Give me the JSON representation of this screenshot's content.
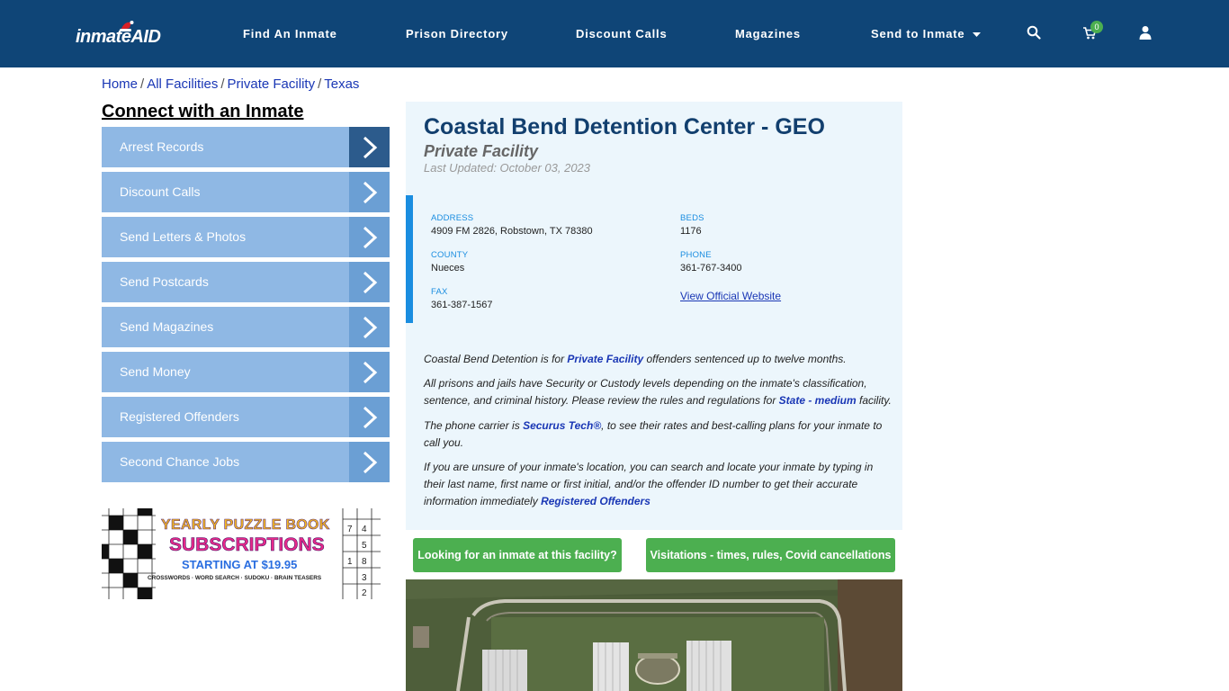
{
  "brand": {
    "logo_main": "inmate",
    "logo_accent": "AID"
  },
  "nav": {
    "items": [
      "Find An Inmate",
      "Prison Directory",
      "Discount Calls",
      "Magazines",
      "Send to Inmate"
    ],
    "cart_count": "0",
    "icons": [
      "search-icon",
      "cart-icon",
      "user-icon"
    ]
  },
  "breadcrumb": [
    "Home",
    "All Facilities",
    "Private Facility",
    "Texas"
  ],
  "sidebar": {
    "title": "Connect with an Inmate",
    "items": [
      "Arrest Records",
      "Discount Calls",
      "Send Letters & Photos",
      "Send Postcards",
      "Send Magazines",
      "Send Money",
      "Registered Offenders",
      "Second Chance Jobs"
    ]
  },
  "ad": {
    "line1": "YEARLY PUZZLE BOOK",
    "line2": "SUBSCRIPTIONS",
    "line3": "STARTING AT $19.95",
    "line4": "CROSSWORDS · WORD SEARCH · SUDOKU · BRAIN TEASERS"
  },
  "facility": {
    "name": "Coastal Bend Detention Center - GEO",
    "type": "Private Facility",
    "updated": "Last Updated: October 03, 2023",
    "address_label": "ADDRESS",
    "address": "4909 FM 2826, Robstown, TX 78380",
    "beds_label": "BEDS",
    "beds": "1176",
    "county_label": "COUNTY",
    "county": "Nueces",
    "phone_label": "PHONE",
    "phone": "361-767-3400",
    "fax_label": "FAX",
    "fax": "361-387-1567",
    "website_link": "View Official Website"
  },
  "description": {
    "p1_a": "Coastal Bend Detention is for ",
    "p1_link": "Private Facility",
    "p1_b": " offenders sentenced up to twelve months.",
    "p2_a": "All prisons and jails have Security or Custody levels depending on the inmate's classification, sentence, and criminal history. Please review the rules and regulations for ",
    "p2_link": "State - medium",
    "p2_b": " facility.",
    "p3_a": "The phone carrier is ",
    "p3_link": "Securus Tech®",
    "p3_b": ", to see their rates and best-calling plans for your inmate to call you.",
    "p4_a": "If you are unsure of your inmate's location, you can search and locate your inmate by typing in their last name, first name or first initial, and/or the offender ID number to get their accurate information immediately ",
    "p4_link": "Registered Offenders"
  },
  "buttons": {
    "looking": "Looking for an inmate at this facility?",
    "visitations": "Visitations - times, rules, Covid cancellations"
  },
  "colors": {
    "header": "#0f4577",
    "accent_blue": "#1a8de0",
    "link": "#1a37b5",
    "green": "#4caf50",
    "sidebar_item": "#8fb8e4"
  }
}
